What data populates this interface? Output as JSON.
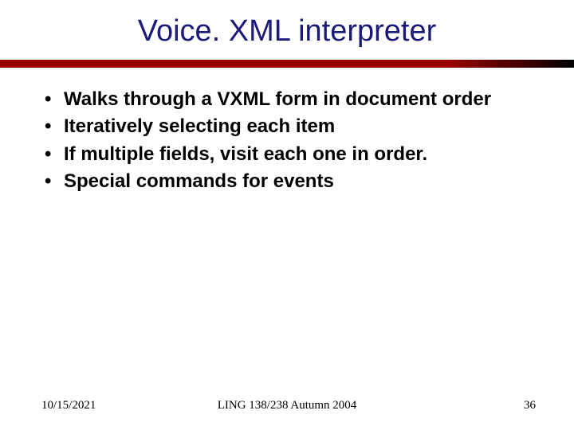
{
  "title": "Voice. XML interpreter",
  "bullets": [
    "Walks through a VXML form in document order",
    "Iteratively selecting each item",
    "If multiple fields, visit each one in order.",
    "Special commands for events"
  ],
  "footer": {
    "date": "10/15/2021",
    "course": "LING 138/238 Autumn 2004",
    "page": "36"
  }
}
